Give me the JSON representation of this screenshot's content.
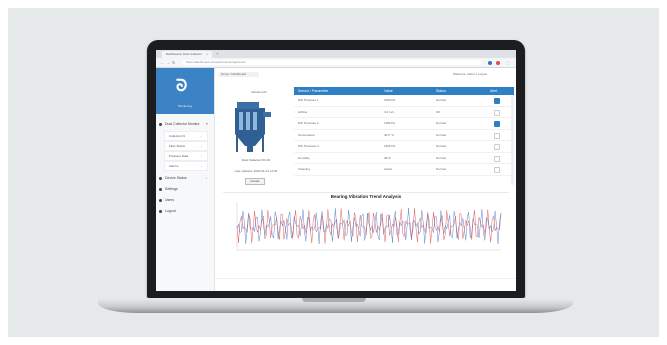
{
  "browser": {
    "tab_title": "Dashboard | Dust Collector",
    "address": "https://dashboard.example/monitoring/device"
  },
  "sidebar": {
    "logo_text": "Monitoring",
    "items": [
      {
        "label": "Dust Collector Monitor"
      },
      {
        "label": "Device Status"
      },
      {
        "label": "Settings"
      },
      {
        "label": "Users"
      },
      {
        "label": "Logout"
      }
    ],
    "sub_items": [
      {
        "label": "Collector 01"
      },
      {
        "label": "Filter Status"
      },
      {
        "label": "Pressure Data"
      },
      {
        "label": "Alarms"
      }
    ]
  },
  "header": {
    "breadcrumb": "Home / Dashboard",
    "user": "Welcome, Admin | Logout"
  },
  "device": {
    "title": "Device Info",
    "caption": "Dust Collector DC-01",
    "sub": "Last updated: 2020-01-01 12:00",
    "button": "Details"
  },
  "table": {
    "headers": [
      "Sensor / Parameter",
      "Value",
      "Status",
      "Alert"
    ],
    "rows": [
      {
        "name": "Diff. Pressure 1",
        "value": "1250 Pa",
        "status": "Normal",
        "alert": true
      },
      {
        "name": "Airflow",
        "value": "3.2 m/s",
        "status": "OK",
        "alert": false
      },
      {
        "name": "Diff. Pressure 2",
        "value": "1180 Pa",
        "status": "Normal",
        "alert": true
      },
      {
        "name": "Temperature",
        "value": "42.5 °C",
        "status": "Normal",
        "alert": false
      },
      {
        "name": "Diff. Pressure 3",
        "value": "1305 Pa",
        "status": "Normal",
        "alert": false
      },
      {
        "name": "Humidity",
        "value": "38 %",
        "status": "Normal",
        "alert": false
      },
      {
        "name": "Cleaning",
        "value": "Active",
        "status": "Normal",
        "alert": false
      }
    ]
  },
  "chart": {
    "title": "Bearing Vibration Trend Analysis"
  },
  "colors": {
    "accent": "#2f7fc4",
    "sidebar_logo": "#3b83c5",
    "series_red": "#d94f4f",
    "series_blue": "#4a78c8"
  }
}
